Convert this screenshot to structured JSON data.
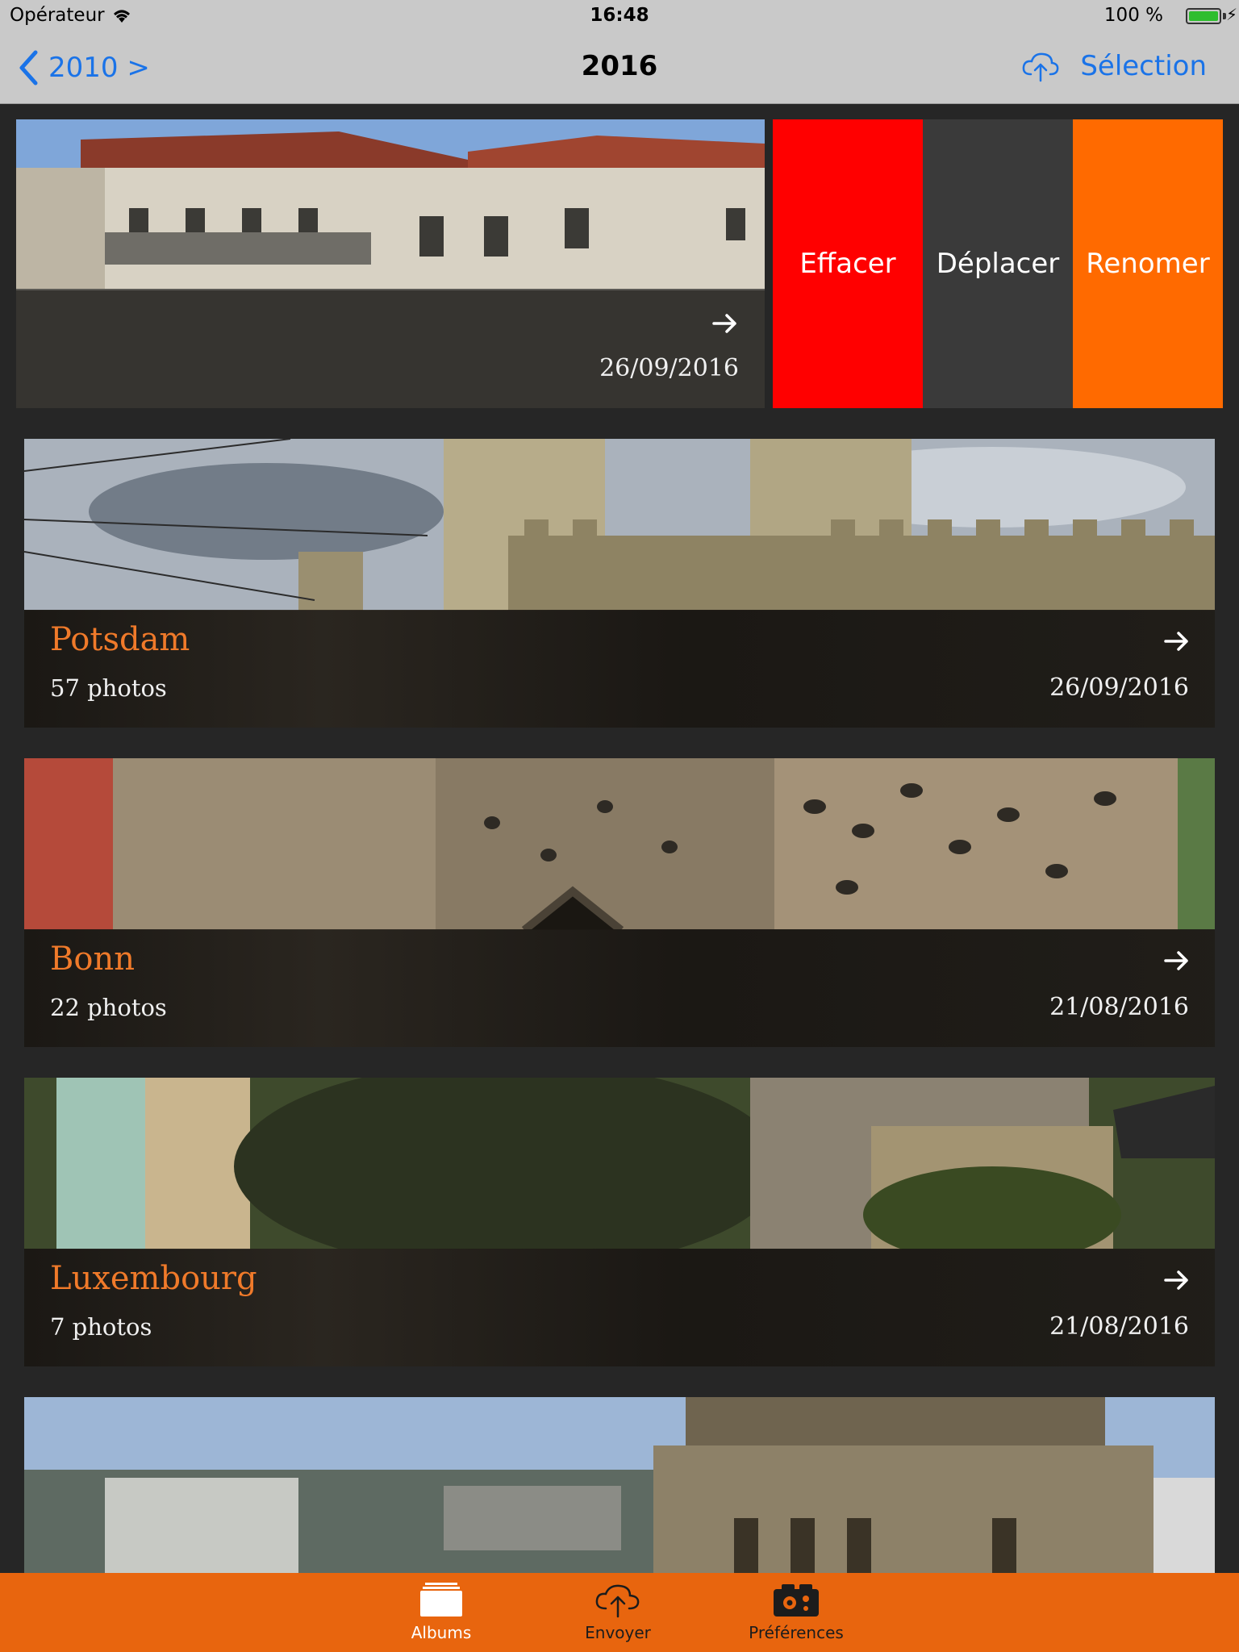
{
  "status_bar": {
    "carrier": "Opérateur",
    "time": "16:48",
    "battery": "100 %"
  },
  "nav": {
    "back_label": "2010 >",
    "title": "2016",
    "select_label": "Sélection"
  },
  "swipe_actions": {
    "delete": "Effacer",
    "move": "Déplacer",
    "rename": "Renomer"
  },
  "colors": {
    "accent": "#e8650e",
    "delete": "#ff0000",
    "move": "#3a3a3a",
    "rename": "#ff6a00",
    "link": "#1a73e8"
  },
  "albums": [
    {
      "date": "26/09/2016"
    },
    {
      "name": "Potsdam",
      "count": "57 photos",
      "date": "26/09/2016"
    },
    {
      "name": "Bonn",
      "count": "22 photos",
      "date": "21/08/2016"
    },
    {
      "name": "Luxembourg",
      "count": "7 photos",
      "date": "21/08/2016"
    }
  ],
  "tabs": [
    {
      "label": "Albums",
      "icon": "albums-icon",
      "active": true
    },
    {
      "label": "Envoyer",
      "icon": "upload-cloud-icon",
      "active": false
    },
    {
      "label": "Préférences",
      "icon": "settings-camera-icon",
      "active": false
    }
  ]
}
